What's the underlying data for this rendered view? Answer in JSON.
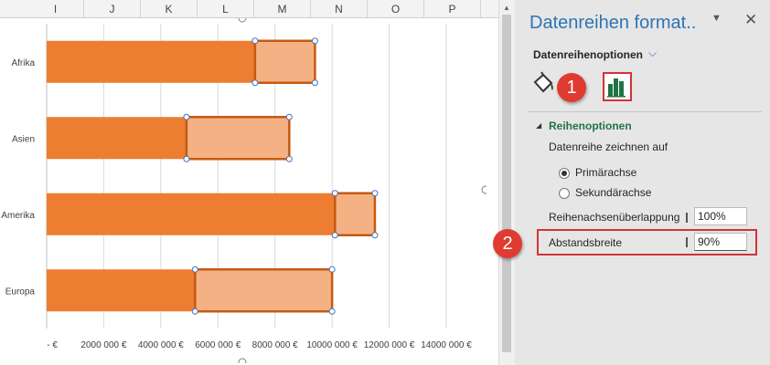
{
  "sheet": {
    "columns": [
      "I",
      "J",
      "K",
      "L",
      "M",
      "N",
      "O",
      "P"
    ]
  },
  "chart_data": {
    "type": "bar",
    "orientation": "horizontal",
    "stacked": true,
    "categories": [
      "Afrika",
      "Asien",
      "Amerika",
      "Europa"
    ],
    "series": [
      {
        "values": [
          7300000,
          4900000,
          10100000,
          5200000
        ],
        "color": "#ed7d31"
      },
      {
        "values": [
          2100000,
          3600000,
          1400000,
          4800000
        ],
        "color": "#f4b183",
        "selected": true
      }
    ],
    "xlim": [
      0,
      14000000
    ],
    "x_ticks": [
      0,
      2000000,
      4000000,
      6000000,
      8000000,
      10000000,
      12000000,
      14000000
    ],
    "x_tick_labels": [
      "- €",
      "2000 000 €",
      "4000 000 €",
      "6000 000 €",
      "8000 000 €",
      "10000 000 €",
      "12000 000 €",
      "14000 000 €"
    ],
    "grid": true,
    "legend": "none"
  },
  "pane": {
    "title": "Datenreihen format..",
    "dropdown_icon": "caret-down-icon",
    "close_icon": "close-icon",
    "subtitle": "Datenreihenoptionen",
    "subtitle_chevron": "chevron-down-icon",
    "tab_icons": [
      "paint-bucket-icon",
      "series-options-icon"
    ],
    "badges": [
      "1",
      "2"
    ],
    "section_title": "Reihenoptionen",
    "plot_on_label": "Datenreihe zeichnen auf",
    "radio_primary": "Primärachse",
    "radio_secondary": "Sekundärachse",
    "radio_selected": "primary",
    "overlap_label": "Reihenachsenüberlappung",
    "overlap_value": "100%",
    "gap_label": "Abstandsbreite",
    "gap_value": "90%"
  },
  "colors": {
    "accent_blue": "#2e75b6",
    "highlight_red": "#d13438",
    "badge_red": "#e03b31",
    "section_green": "#217346"
  }
}
